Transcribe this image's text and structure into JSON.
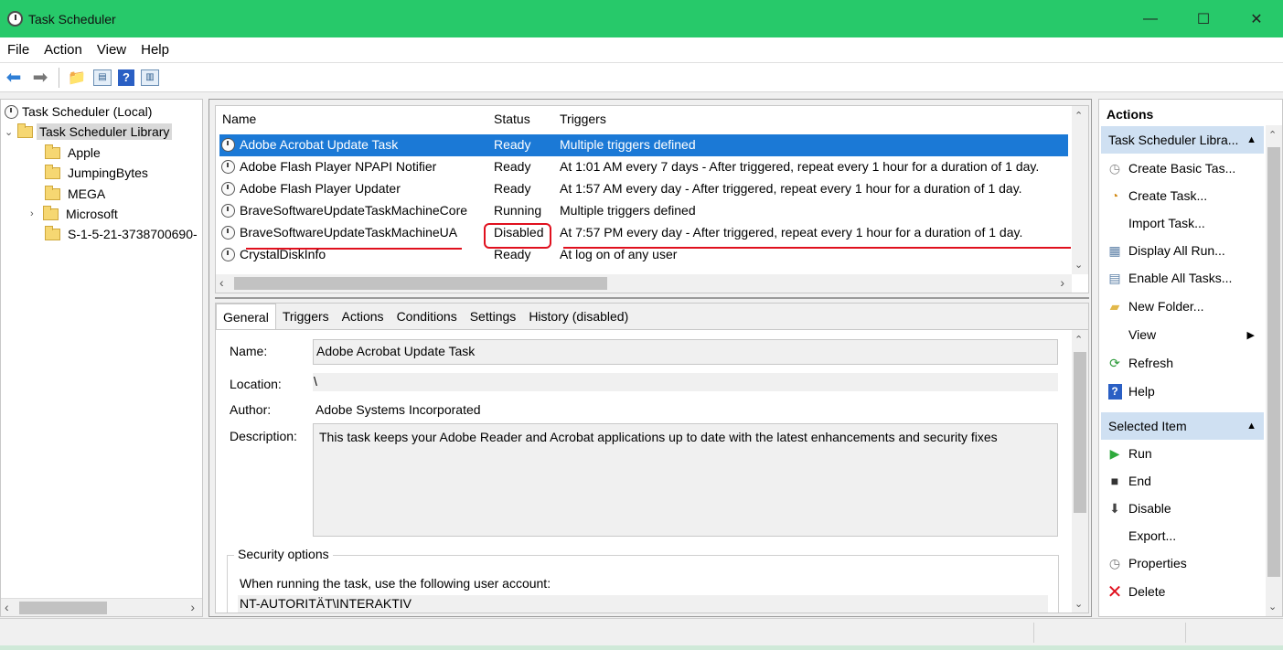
{
  "window": {
    "title": "Task Scheduler",
    "minimize": "—",
    "maximize": "☐",
    "close": "✕"
  },
  "menu": [
    "File",
    "Action",
    "View",
    "Help"
  ],
  "tree": {
    "root": "Task Scheduler (Local)",
    "library": "Task Scheduler Library",
    "folders": [
      "Apple",
      "JumpingBytes",
      "MEGA",
      "Microsoft",
      "S-1-5-21-3738700690-"
    ]
  },
  "tasklist": {
    "columns": {
      "name": "Name",
      "status": "Status",
      "triggers": "Triggers"
    },
    "rows": [
      {
        "name": "Adobe Acrobat Update Task",
        "status": "Ready",
        "triggers": "Multiple triggers defined"
      },
      {
        "name": "Adobe Flash Player NPAPI Notifier",
        "status": "Ready",
        "triggers": "At 1:01 AM every 7 days - After triggered, repeat every 1 hour for a duration of 1 day."
      },
      {
        "name": "Adobe Flash Player Updater",
        "status": "Ready",
        "triggers": "At 1:57 AM every day - After triggered, repeat every 1 hour for a duration of 1 day."
      },
      {
        "name": "BraveSoftwareUpdateTaskMachineCore",
        "status": "Running",
        "triggers": "Multiple triggers defined"
      },
      {
        "name": "BraveSoftwareUpdateTaskMachineUA",
        "status": "Disabled",
        "triggers": "At 7:57 PM every day - After triggered, repeat every 1 hour for a duration of 1 day."
      },
      {
        "name": "CrystalDiskInfo",
        "status": "Ready",
        "triggers": "At log on of any user"
      }
    ]
  },
  "details": {
    "tabs": [
      "General",
      "Triggers",
      "Actions",
      "Conditions",
      "Settings",
      "History (disabled)"
    ],
    "name_label": "Name:",
    "name_value": "Adobe Acrobat Update Task",
    "location_label": "Location:",
    "location_value": "\\",
    "author_label": "Author:",
    "author_value": "Adobe Systems Incorporated",
    "description_label": "Description:",
    "description_value": "This task keeps your Adobe Reader and Acrobat applications up to date with the latest enhancements and security fixes",
    "security_label": "Security options",
    "security_text": "When running the task, use the following user account:",
    "security_account": "NT-AUTORITÄT\\INTERAKTIV"
  },
  "actions": {
    "title": "Actions",
    "section1": "Task Scheduler Libra...",
    "items1": [
      "Create Basic Tas...",
      "Create Task...",
      "Import Task...",
      "Display All Run...",
      "Enable All Tasks...",
      "New Folder...",
      "View",
      "Refresh",
      "Help"
    ],
    "section2": "Selected Item",
    "items2": [
      "Run",
      "End",
      "Disable",
      "Export...",
      "Properties",
      "Delete"
    ]
  },
  "colors": {
    "titlebar": "#27c96a",
    "selection": "#1b79d6",
    "annotation": "#e0101e"
  }
}
